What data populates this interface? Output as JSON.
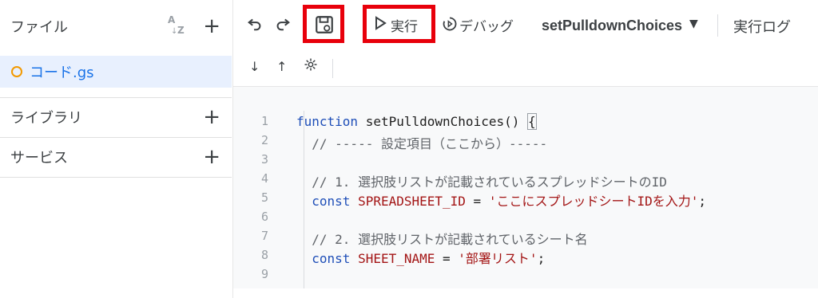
{
  "sidebar": {
    "title": "ファイル",
    "sort_a": "A",
    "sort_z": "Z",
    "file_name": "コード.gs",
    "libraries": "ライブラリ",
    "services": "サービス",
    "plus": "+"
  },
  "toolbar": {
    "run_label": "実行",
    "debug_label": "デバッグ",
    "function_name": "setPulldownChoices",
    "log_label": "実行ログ"
  },
  "editor": {
    "lines": [
      {
        "n": "1",
        "parts": [
          [
            "kw",
            "function "
          ],
          [
            "fn",
            "setPulldownChoices() "
          ],
          [
            "fn",
            "{"
          ]
        ]
      },
      {
        "n": "2",
        "parts": [
          [
            "cm",
            "  // ----- 設定項目（ここから）-----"
          ]
        ]
      },
      {
        "n": "3",
        "parts": []
      },
      {
        "n": "4",
        "parts": [
          [
            "cm",
            "  // 1. 選択肢リストが記載されているスプレッドシートのID"
          ]
        ]
      },
      {
        "n": "5",
        "parts": [
          [
            "kw",
            "  const "
          ],
          [
            "var",
            "SPREADSHEET_ID"
          ],
          [
            "fn",
            " = "
          ],
          [
            "str",
            "'ここにスプレッドシートIDを入力'"
          ],
          [
            "fn",
            ";"
          ]
        ]
      },
      {
        "n": "6",
        "parts": []
      },
      {
        "n": "7",
        "parts": [
          [
            "cm",
            "  // 2. 選択肢リストが記載されているシート名"
          ]
        ]
      },
      {
        "n": "8",
        "parts": [
          [
            "kw",
            "  const "
          ],
          [
            "var",
            "SHEET_NAME"
          ],
          [
            "fn",
            " = "
          ],
          [
            "str",
            "'部署リスト'"
          ],
          [
            "fn",
            ";"
          ]
        ]
      },
      {
        "n": "9",
        "parts": []
      }
    ]
  }
}
